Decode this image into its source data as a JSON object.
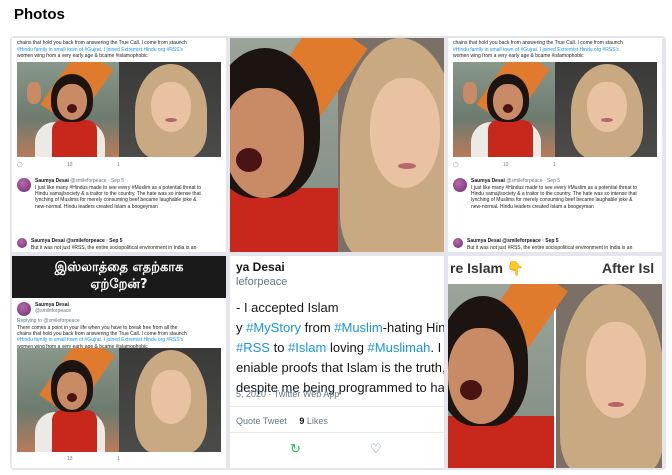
{
  "header": {
    "title": "Photos"
  },
  "tweet_shot": {
    "intro_text_a": "chains that hold you back from answering the True Call. I come from staunch",
    "intro_text_b": "#Hindu family in small town of #Gujrat. I joined Extremist Hindu org #RSS's",
    "intro_text_c": "women wing from a very early age & bcame #islamophobic",
    "counts": {
      "reply": "←",
      "retweet": "13",
      "like": "1"
    },
    "author": "Saumya Desai",
    "handle": "@smileforpeace · Sep 5",
    "body_a": "I just like many #Hindus made to see every #Muslim as a potential threat to",
    "body_b": "Hindu samaj/society & a traitor to the country. The hate was so intense that",
    "body_c": "lynching of Muslims for merely consuming beef became laughable joke &",
    "body_d": "new-normal. Hindu leaders created Islam a boogeyman",
    "next_handle": "Saumya Desai @smileforpeace · Sep 5",
    "next_text": "But it was not just #RSS, the entire sociopolitical environment in India is an"
  },
  "tile4": {
    "banner_line1": "இஸ்லாத்தை எதற்காக",
    "banner_line2": "ஏற்றேன்?",
    "author": "Saumya Desai",
    "handle": "@smileforpeace",
    "replying": "Replying to @smileforpeace",
    "body_a": "There comes a point in your life when you have to break free from all the",
    "body_b": "chains that hold you back from answering the True Call. I come from staunch",
    "body_c": "#Hindu family in small town of #Gujrat. I joined Extremist Hindu org #RSS's",
    "body_d": "women wing from a very early age & bcame #islamophobic"
  },
  "tile5": {
    "name": "ya Desai",
    "handle": "leforpeace",
    "line1": "- I accepted Islam",
    "line2_a": "y ",
    "line2_tag1": "#MyStory",
    "line2_b": " from ",
    "line2_tag2": "#Muslim",
    "line2_c": "-hating Hin",
    "line3_a": "",
    "line3_tag1": "#RSS",
    "line3_b": " to ",
    "line3_tag2": "#Islam",
    "line3_c": " loving ",
    "line3_tag3": "#Muslimah",
    "line3_d": ". I a",
    "line4": "eniable proofs that Islam is the truth, I",
    "line5": "despite me being programmed to hat",
    "meta": "5, 2020 · Twitter Web App",
    "quote_tweet": "Quote Tweet",
    "likes_count": "9",
    "likes_label": "Likes"
  },
  "tile6": {
    "left_label": "re Islam 👇",
    "right_label": "After Isl"
  },
  "colors": {
    "link": "#1b95e0",
    "retweet_green": "#17bf63",
    "banner": "#1a1a1a"
  }
}
